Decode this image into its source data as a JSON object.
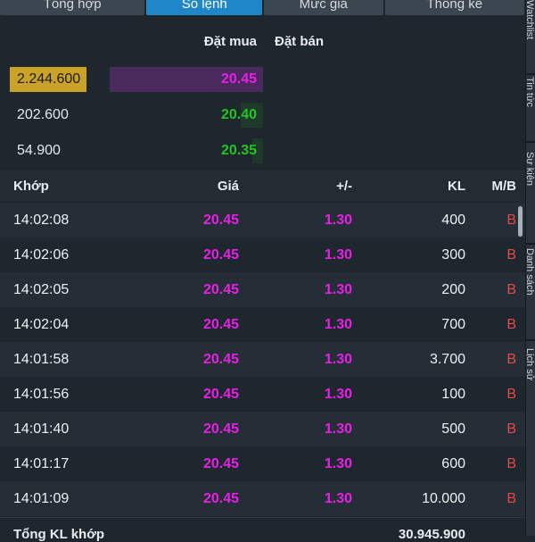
{
  "tabs": [
    {
      "label": "Tổng hợp",
      "active": false
    },
    {
      "label": "Sổ lệnh",
      "active": true
    },
    {
      "label": "Mức giá",
      "active": false
    },
    {
      "label": "Thống kê",
      "active": false
    }
  ],
  "side_tabs": [
    "Watchlist",
    "Tin tức",
    "Sự kiện",
    "Danh sách",
    "Lịch sử"
  ],
  "orderbook": {
    "buy_header": "Đặt mua",
    "sell_header": "Đặt bán",
    "rows": [
      {
        "volume": "2.244.600",
        "price": "20.45",
        "price_color": "#e81fe6",
        "highlight": true,
        "bar_color": "#4a2a5c"
      },
      {
        "volume": "202.600",
        "price": "20.40",
        "price_color": "#22c522",
        "highlight": false,
        "bar_color": "#1f3a2a"
      },
      {
        "volume": "54.900",
        "price": "20.35",
        "price_color": "#22c522",
        "highlight": false,
        "bar_color": "#1f3a2a"
      }
    ]
  },
  "trades": {
    "headers": {
      "time": "Khớp",
      "price": "Giá",
      "change": "+/-",
      "volume": "KL",
      "side": "M/B"
    },
    "rows": [
      {
        "time": "14:02:08",
        "price": "20.45",
        "change": "1.30",
        "volume": "400",
        "side": "B"
      },
      {
        "time": "14:02:06",
        "price": "20.45",
        "change": "1.30",
        "volume": "300",
        "side": "B"
      },
      {
        "time": "14:02:05",
        "price": "20.45",
        "change": "1.30",
        "volume": "200",
        "side": "B"
      },
      {
        "time": "14:02:04",
        "price": "20.45",
        "change": "1.30",
        "volume": "700",
        "side": "B"
      },
      {
        "time": "14:01:58",
        "price": "20.45",
        "change": "1.30",
        "volume": "3.700",
        "side": "B"
      },
      {
        "time": "14:01:56",
        "price": "20.45",
        "change": "1.30",
        "volume": "100",
        "side": "B"
      },
      {
        "time": "14:01:40",
        "price": "20.45",
        "change": "1.30",
        "volume": "500",
        "side": "B"
      },
      {
        "time": "14:01:17",
        "price": "20.45",
        "change": "1.30",
        "volume": "600",
        "side": "B"
      },
      {
        "time": "14:01:09",
        "price": "20.45",
        "change": "1.30",
        "volume": "10.000",
        "side": "B"
      }
    ]
  },
  "footer": {
    "label": "Tổng KL khớp",
    "value": "30.945.900"
  }
}
